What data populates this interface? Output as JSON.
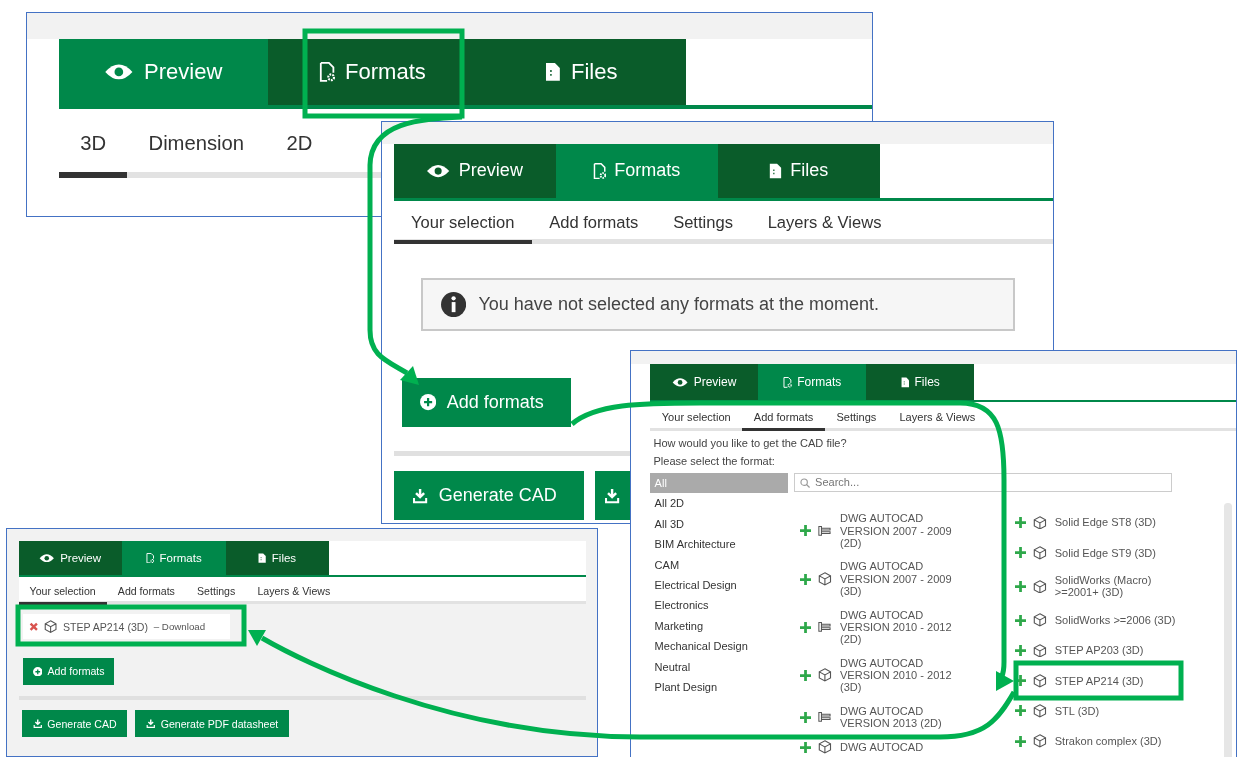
{
  "overview_panel": {
    "tabs": [
      {
        "label": "Preview",
        "selected": true
      },
      {
        "label": "Formats",
        "selected": false
      },
      {
        "label": "Files",
        "selected": false
      }
    ],
    "subtabs": [
      {
        "label": "3D",
        "selected": true
      },
      {
        "label": "Dimension",
        "selected": false
      },
      {
        "label": "2D",
        "selected": false
      }
    ]
  },
  "empty_selection_panel": {
    "tabs": [
      {
        "label": "Preview",
        "selected": false
      },
      {
        "label": "Formats",
        "selected": true
      },
      {
        "label": "Files",
        "selected": false
      }
    ],
    "subtabs": [
      {
        "label": "Your selection",
        "selected": true
      },
      {
        "label": "Add formats",
        "selected": false
      },
      {
        "label": "Settings",
        "selected": false
      },
      {
        "label": "Layers & Views",
        "selected": false
      }
    ],
    "notice": "You have not selected any formats at the moment.",
    "add_button": "Add formats",
    "action_buttons": [
      "Generate CAD"
    ]
  },
  "add_formats_panel": {
    "tabs": [
      {
        "label": "Preview",
        "selected": false
      },
      {
        "label": "Formats",
        "selected": true
      },
      {
        "label": "Files",
        "selected": false
      }
    ],
    "subtabs": [
      {
        "label": "Your selection",
        "selected": false
      },
      {
        "label": "Add formats",
        "selected": true
      },
      {
        "label": "Settings",
        "selected": false
      },
      {
        "label": "Layers & Views",
        "selected": false
      }
    ],
    "question": "How would you like to get the CAD file?",
    "instruction": "Please select the format:",
    "categories": [
      {
        "label": "All",
        "selected": true
      },
      {
        "label": "All 2D",
        "selected": false
      },
      {
        "label": "All 3D",
        "selected": false
      },
      {
        "label": "BIM Architecture",
        "selected": false
      },
      {
        "label": "CAM",
        "selected": false
      },
      {
        "label": "Electrical Design",
        "selected": false
      },
      {
        "label": "Electronics",
        "selected": false
      },
      {
        "label": "Marketing",
        "selected": false
      },
      {
        "label": "Mechanical Design",
        "selected": false
      },
      {
        "label": "Neutral",
        "selected": false
      },
      {
        "label": "Plant Design",
        "selected": false
      }
    ],
    "search": {
      "placeholder": "Search..."
    },
    "format_columns": [
      [
        {
          "label": "DWG AUTOCAD VERSION 2007 - 2009 (2D)",
          "kind": "flat"
        },
        {
          "label": "DWG AUTOCAD VERSION 2007 - 2009 (3D)",
          "kind": "solid"
        },
        {
          "label": "DWG AUTOCAD VERSION 2010 - 2012 (2D)",
          "kind": "flat"
        },
        {
          "label": "DWG AUTOCAD VERSION 2010 - 2012 (3D)",
          "kind": "solid"
        },
        {
          "label": "DWG AUTOCAD VERSION 2013 (2D)",
          "kind": "flat"
        },
        {
          "label": "DWG AUTOCAD",
          "kind": "solid"
        }
      ],
      [
        {
          "label": "Solid Edge ST8 (3D)",
          "kind": "solid"
        },
        {
          "label": "Solid Edge ST9 (3D)",
          "kind": "solid"
        },
        {
          "label": "SolidWorks (Macro) >=2001+ (3D)",
          "kind": "solid"
        },
        {
          "label": "SolidWorks >=2006 (3D)",
          "kind": "solid"
        },
        {
          "label": "STEP AP203 (3D)",
          "kind": "solid"
        },
        {
          "label": "STEP AP214 (3D)",
          "kind": "solid"
        },
        {
          "label": "STL (3D)",
          "kind": "solid"
        },
        {
          "label": "Strakon complex (3D)",
          "kind": "solid"
        }
      ]
    ]
  },
  "selection_panel": {
    "tabs": [
      {
        "label": "Preview",
        "selected": false
      },
      {
        "label": "Formats",
        "selected": true
      },
      {
        "label": "Files",
        "selected": false
      }
    ],
    "subtabs": [
      {
        "label": "Your selection",
        "selected": true
      },
      {
        "label": "Add formats",
        "selected": false
      },
      {
        "label": "Settings",
        "selected": false
      },
      {
        "label": "Layers & Views",
        "selected": false
      }
    ],
    "selected_format": {
      "name": "STEP AP214 (3D)",
      "link": "– Download"
    },
    "add_button": "Add formats",
    "action_buttons": [
      "Generate CAD",
      "Generate PDF datasheet"
    ]
  }
}
